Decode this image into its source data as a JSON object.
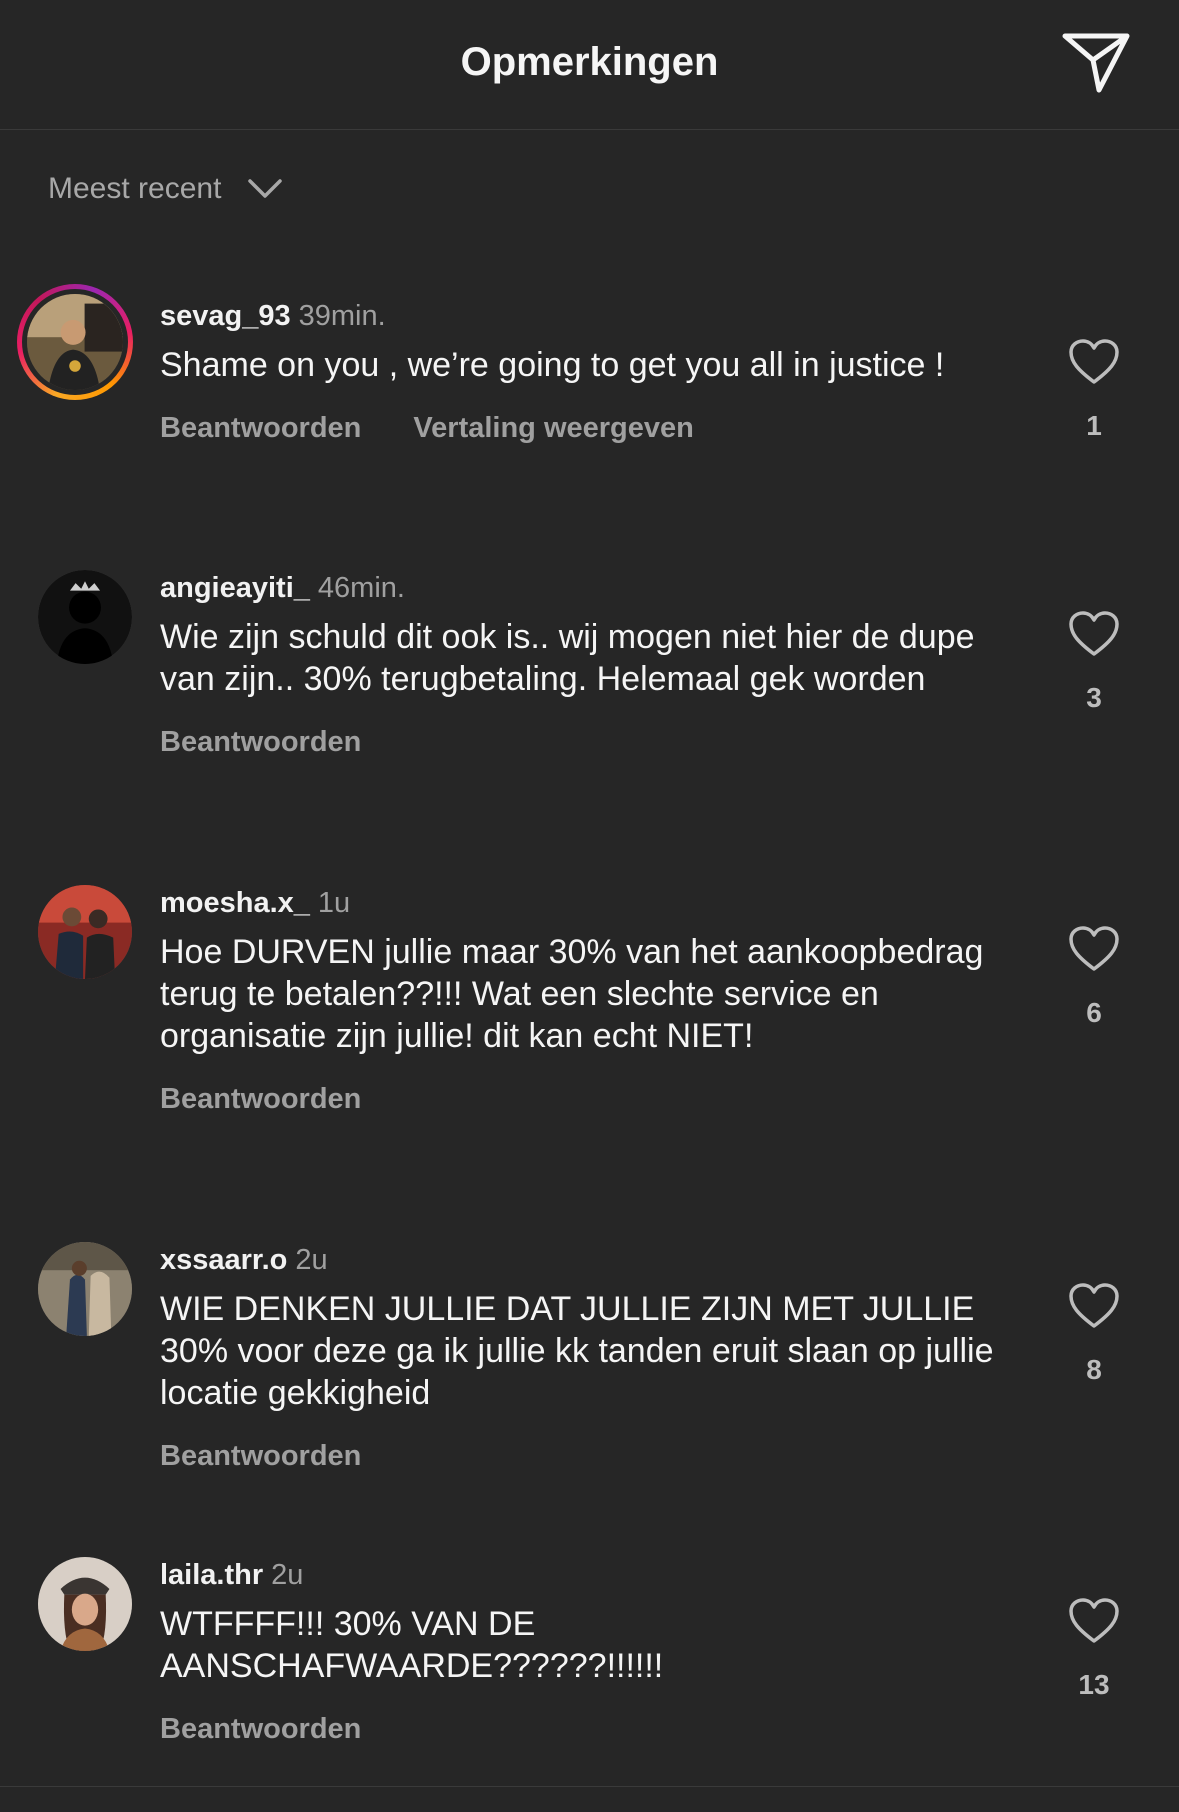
{
  "header": {
    "title": "Opmerkingen",
    "share_icon": "paper-plane-icon"
  },
  "sort": {
    "label": "Meest recent",
    "icon": "chevron-down-icon"
  },
  "colors": {
    "background": "#262626",
    "text": "#f5f5f5",
    "muted": "#a0a0a0",
    "divider": "#3a3a3a"
  },
  "comments": [
    {
      "username": "sevag_93",
      "time": "39min.",
      "text": "Shame on you , we’re going to get you all in justice !",
      "reply": "Beantwoorden",
      "translate": "Vertaling weergeven",
      "likes": "1",
      "has_story": true
    },
    {
      "username": "angieayiti_",
      "time": "46min.",
      "text": "Wie zijn schuld dit ook is.. wij mogen niet hier de dupe van zijn.. 30% terugbetaling. Helemaal gek worden",
      "reply": "Beantwoorden",
      "likes": "3"
    },
    {
      "username": "moesha.x_",
      "time": "1u",
      "text": "Hoe DURVEN jullie maar 30% van het aankoopbedrag terug te betalen??!!! Wat een slechte service en organisatie zijn jullie! dit kan echt NIET!",
      "reply": "Beantwoorden",
      "likes": "6"
    },
    {
      "username": "xssaarr.o",
      "time": "2u",
      "text": "WIE DENKEN JULLIE DAT JULLIE ZIJN MET JULLIE 30% voor deze ga ik jullie kk tanden eruit slaan op jullie locatie gekkigheid",
      "reply": "Beantwoorden",
      "likes": "8"
    },
    {
      "username": "laila.thr",
      "time": "2u",
      "text": "WTFFFF!!! 30% VAN DE AANSCHAFWAARDE??????!!!!!!",
      "reply": "Beantwoorden",
      "likes": "13"
    }
  ]
}
